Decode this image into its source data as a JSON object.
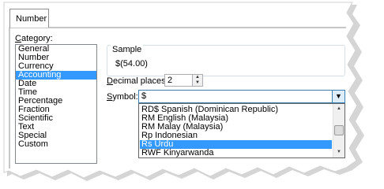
{
  "tab": {
    "label": "Number"
  },
  "category": {
    "label": "Category:",
    "items": [
      "General",
      "Number",
      "Currency",
      "Accounting",
      "Date",
      "Time",
      "Percentage",
      "Fraction",
      "Scientific",
      "Text",
      "Special",
      "Custom"
    ],
    "selected": "Accounting"
  },
  "sample": {
    "title": "Sample",
    "value": "$(54.00)"
  },
  "decimal_places": {
    "label": "Decimal places:",
    "value": "2"
  },
  "symbol": {
    "label": "Symbol:",
    "value": "$",
    "options": [
      "RD$ Spanish (Dominican Republic)",
      "RM English (Malaysia)",
      "RM Malay (Malaysia)",
      "Rp Indonesian",
      "Rs Urdu",
      "RWF Kinyarwanda"
    ],
    "selected": "Rs Urdu"
  },
  "colors": {
    "selection": "#3399ff",
    "combo_border": "#3c7fb1"
  }
}
